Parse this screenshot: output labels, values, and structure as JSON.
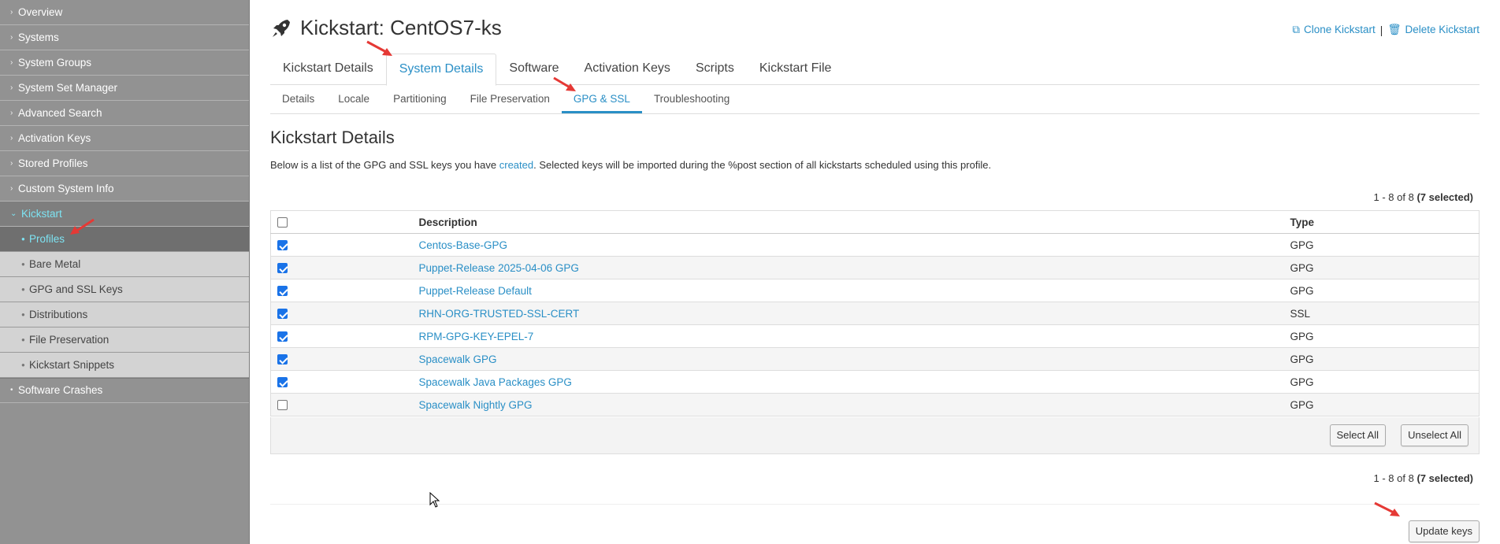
{
  "sidebar": {
    "items": [
      {
        "label": "Overview"
      },
      {
        "label": "Systems"
      },
      {
        "label": "System Groups"
      },
      {
        "label": "System Set Manager"
      },
      {
        "label": "Advanced Search"
      },
      {
        "label": "Activation Keys"
      },
      {
        "label": "Stored Profiles"
      },
      {
        "label": "Custom System Info"
      }
    ],
    "kickstart_label": "Kickstart",
    "kickstart_subitems": [
      {
        "label": "Profiles",
        "active": true
      },
      {
        "label": "Bare Metal"
      },
      {
        "label": "GPG and SSL Keys"
      },
      {
        "label": "Distributions"
      },
      {
        "label": "File Preservation"
      },
      {
        "label": "Kickstart Snippets"
      }
    ],
    "after_items": [
      {
        "label": "Software Crashes"
      }
    ]
  },
  "header": {
    "title": "Kickstart: CentOS7-ks",
    "clone_label": "Clone Kickstart",
    "delete_label": "Delete Kickstart",
    "separator": "|"
  },
  "tabs": [
    {
      "label": "Kickstart Details"
    },
    {
      "label": "System Details",
      "active": true
    },
    {
      "label": "Software"
    },
    {
      "label": "Activation Keys"
    },
    {
      "label": "Scripts"
    },
    {
      "label": "Kickstart File"
    }
  ],
  "subtabs": [
    {
      "label": "Details"
    },
    {
      "label": "Locale"
    },
    {
      "label": "Partitioning"
    },
    {
      "label": "File Preservation"
    },
    {
      "label": "GPG & SSL",
      "active": true
    },
    {
      "label": "Troubleshooting"
    }
  ],
  "content": {
    "section_title": "Kickstart Details",
    "desc_before": "Below is a list of the GPG and SSL keys you have ",
    "desc_link": "created",
    "desc_after": ". Selected keys will be imported during the %post section of all kickstarts scheduled using this profile.",
    "pager_range": "1 - 8 of 8",
    "pager_selected": "(7 selected)"
  },
  "table": {
    "columns": [
      "Description",
      "Type"
    ],
    "rows": [
      {
        "description": "Centos-Base-GPG",
        "type": "GPG",
        "checked": true
      },
      {
        "description": "Puppet-Release 2025-04-06 GPG",
        "type": "GPG",
        "checked": true
      },
      {
        "description": "Puppet-Release Default",
        "type": "GPG",
        "checked": true
      },
      {
        "description": "RHN-ORG-TRUSTED-SSL-CERT",
        "type": "SSL",
        "checked": true
      },
      {
        "description": "RPM-GPG-KEY-EPEL-7",
        "type": "GPG",
        "checked": true
      },
      {
        "description": "Spacewalk GPG",
        "type": "GPG",
        "checked": true
      },
      {
        "description": "Spacewalk Java Packages GPG",
        "type": "GPG",
        "checked": true
      },
      {
        "description": "Spacewalk Nightly GPG",
        "type": "GPG",
        "checked": false
      }
    ]
  },
  "buttons": {
    "select_all": "Select All",
    "unselect_all": "Unselect All",
    "update_keys": "Update keys"
  },
  "colors": {
    "accent": "#2a8fc6",
    "sidebar_bg": "#929292",
    "sidebar_active": "#7de3f2",
    "annotation_arrow": "#e53935"
  }
}
